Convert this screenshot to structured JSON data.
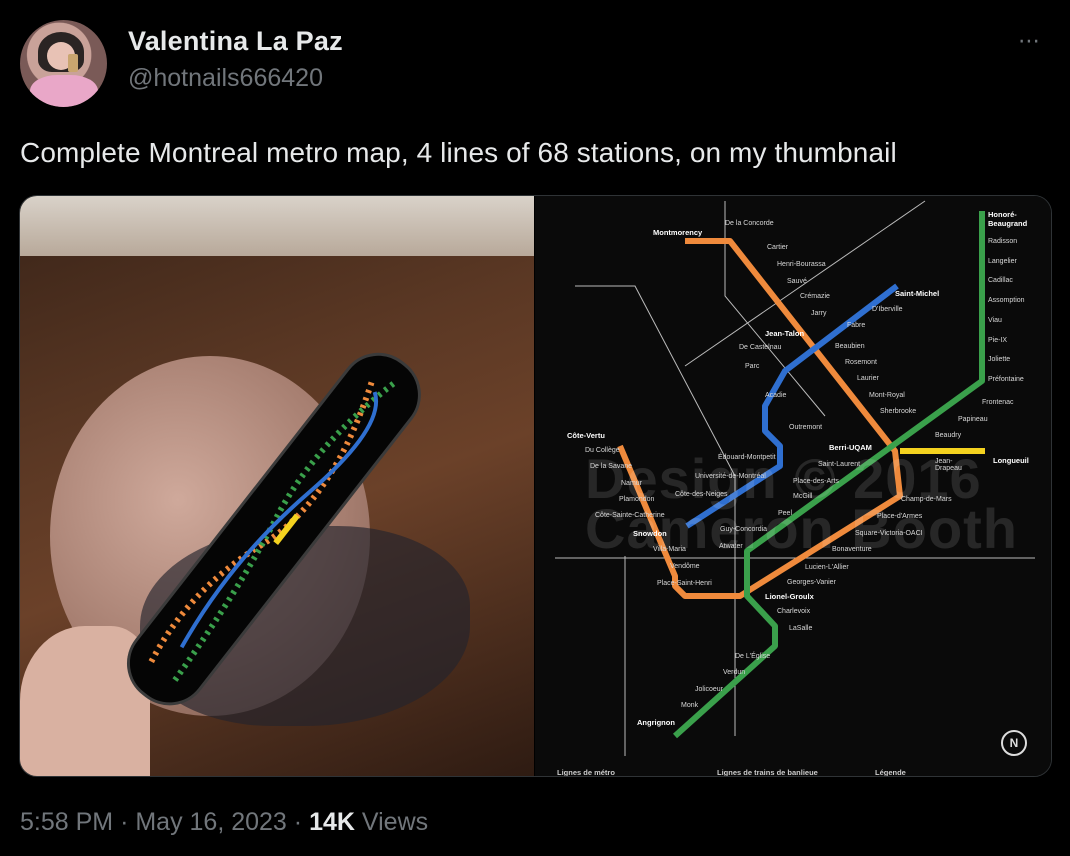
{
  "user": {
    "display_name": "Valentina La Paz",
    "handle": "@hotnails666420"
  },
  "more_icon": "⋯",
  "tweet": {
    "text": "Complete Montreal metro map, 4 lines of 68 stations, on my thumbnail"
  },
  "meta": {
    "time": "5:58 PM",
    "sep1": "·",
    "date": "May 16, 2023",
    "sep2": "·",
    "views_count": "14K",
    "views_label": "Views"
  },
  "colors": {
    "orange": "#ef8a3c",
    "green": "#3aa04b",
    "blue": "#2f6fd0",
    "yellow": "#f4d21f"
  },
  "map": {
    "watermark1": "Design © 2016",
    "watermark2": "Cameron Booth",
    "north_label": "N",
    "legend": [
      "Lignes de métro",
      "Lignes de trains de banlieue",
      "Légende"
    ],
    "stations": {
      "montmorency": "Montmorency",
      "de_la_concorde": "De la Concorde",
      "cartier": "Cartier",
      "henri_bourassa": "Henri-Bourassa",
      "sauve": "Sauvé",
      "cremazie": "Crémazie",
      "jarry": "Jarry",
      "jean_talon": "Jean-Talon",
      "de_castelnau": "De Castelnau",
      "parc": "Parc",
      "acadie": "Acadie",
      "outremont": "Outremont",
      "edouard_montpetit": "Édouard-Montpetit",
      "universite": "Université-de-Montréal",
      "cote_des_neiges": "Côte-des-Neiges",
      "snowdon": "Snowdon",
      "cote_vertu": "Côte-Vertu",
      "du_college": "Du Collège",
      "de_la_savane": "De la Savane",
      "namur": "Namur",
      "plamondon": "Plamondon",
      "cote_ste_catherine": "Côte-Sainte-Catherine",
      "villa_maria": "Villa-Maria",
      "vendome": "Vendôme",
      "place_st_henri": "Place-Saint-Henri",
      "lionel_groulx": "Lionel-Groulx",
      "charlevoix": "Charlevoix",
      "lasalle": "LaSalle",
      "de_leglise": "De L'Église",
      "verdun": "Verdun",
      "jolicoeur": "Jolicoeur",
      "monk": "Monk",
      "angrignon": "Angrignon",
      "saint_michel": "Saint-Michel",
      "diberville": "D'Iberville",
      "fabre": "Fabre",
      "beaubien": "Beaubien",
      "rosemont": "Rosemont",
      "laurier": "Laurier",
      "mont_royal": "Mont-Royal",
      "sherbrooke": "Sherbrooke",
      "berri_uqam": "Berri-UQAM",
      "saint_laurent": "Saint-Laurent",
      "place_des_arts": "Place-des-Arts",
      "mcgill": "McGill",
      "peel": "Peel",
      "guy_concordia": "Guy-Concordia",
      "atwater": "Atwater",
      "lucien_lallier": "Lucien-L'Allier",
      "georges_vanier": "Georges-Vanier",
      "bonaventure": "Bonaventure",
      "square_victoria": "Square-Victoria-OACI",
      "place_darmes": "Place-d'Armes",
      "champ_de_mars": "Champ-de-Mars",
      "beaudry": "Beaudry",
      "papineau": "Papineau",
      "frontenac": "Frontenac",
      "prefontaine": "Préfontaine",
      "joliette": "Joliette",
      "pie_ix": "Pie-IX",
      "viau": "Viau",
      "assomption": "Assomption",
      "cadillac": "Cadillac",
      "langelier": "Langelier",
      "radisson": "Radisson",
      "honore_beaugrand": "Honoré-Beaugrand",
      "jean_drapeau": "Jean-Drapeau",
      "longueuil": "Longueuil"
    }
  }
}
